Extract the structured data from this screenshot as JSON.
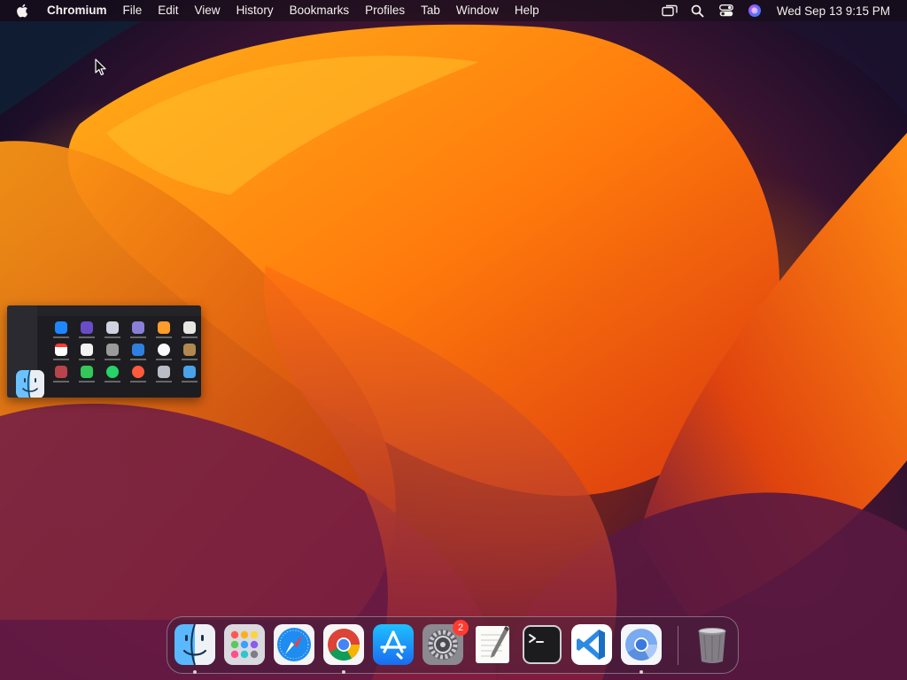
{
  "menubar": {
    "app_name": "Chromium",
    "items": [
      "File",
      "Edit",
      "View",
      "History",
      "Bookmarks",
      "Profiles",
      "Tab",
      "Window",
      "Help"
    ],
    "status_icons": [
      "screen-mirroring-icon",
      "spotlight-search-icon",
      "control-center-icon",
      "siri-icon"
    ],
    "clock": "Wed Sep 13  9:15 PM"
  },
  "minimized_window": {
    "app": "Finder",
    "icon": "finder-icon"
  },
  "dock": {
    "apps": [
      {
        "name": "Finder",
        "icon": "finder-icon",
        "running": true
      },
      {
        "name": "Launchpad",
        "icon": "launchpad-icon",
        "running": false
      },
      {
        "name": "Safari",
        "icon": "safari-icon",
        "running": false
      },
      {
        "name": "Google Chrome",
        "icon": "chrome-icon",
        "running": true
      },
      {
        "name": "App Store",
        "icon": "app-store-icon",
        "running": false
      },
      {
        "name": "System Settings",
        "icon": "system-settings-icon",
        "running": false,
        "badge": "2"
      },
      {
        "name": "TextEdit",
        "icon": "textedit-icon",
        "running": false
      },
      {
        "name": "Terminal",
        "icon": "terminal-icon",
        "running": false
      },
      {
        "name": "Visual Studio Code",
        "icon": "vscode-icon",
        "running": false
      },
      {
        "name": "Chromium",
        "icon": "chromium-icon",
        "running": true
      }
    ],
    "trash": {
      "name": "Trash",
      "icon": "trash-icon"
    }
  },
  "colors": {
    "accent_orange": "#ff9a12",
    "badge_red": "#ff3b30"
  }
}
